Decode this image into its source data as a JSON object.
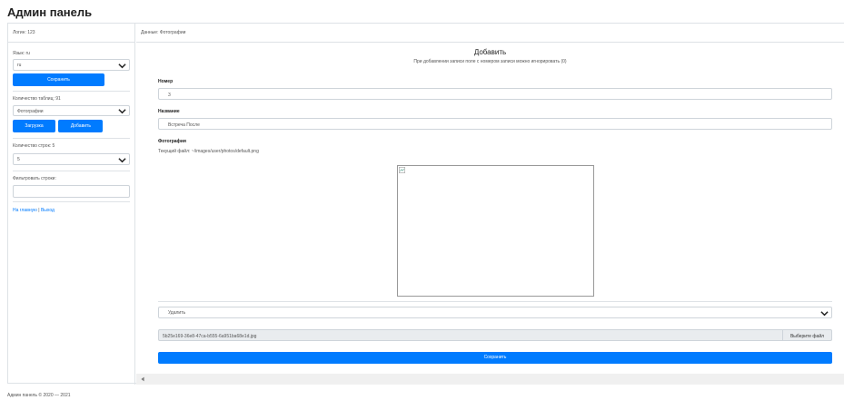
{
  "page": {
    "title": "Админ панель"
  },
  "sidebar": {
    "login": "Логин: 123",
    "language_label": "Язык: ru",
    "language_value": "ru",
    "save_label": "Сохранить",
    "tables_count_label": "Количество таблиц: 91",
    "table_value": "Фотографии",
    "upload_label": "Загрузка",
    "add_label": "Добавить",
    "rows_count_label": "Количество строк: 5",
    "rows_value": "5",
    "filter_label": "Фильтровать строки:",
    "filter_value": "",
    "link_home": "На главную",
    "link_separator": "|",
    "link_logout": "Выход"
  },
  "main": {
    "data_label": "Данные: Фотографии",
    "form_title": "Добавить",
    "form_subtitle": "При добавлении записи поле с номером записи можно игнорировать (0)",
    "number_label": "Номер",
    "number_value": "3",
    "name_label": "Название",
    "name_value": "Встреча После",
    "photo_label": "Фотография",
    "current_file": "Текущий файл: ~/images/user/photos/default.png",
    "delete_select_value": "Удалить",
    "file_name": "5b25e169-36e8-47ca-b555-6a951ba68e1d.jpg",
    "choose_file_label": "Выберите файл",
    "save_label": "Сохранить"
  },
  "footer": {
    "text": "Админ панель © 2020 — 2021"
  },
  "colors": {
    "accent": "#007bff",
    "border": "#dee2e6"
  },
  "icons": [
    "chevron-down-icon",
    "broken-image-icon",
    "scroll-left-icon"
  ]
}
